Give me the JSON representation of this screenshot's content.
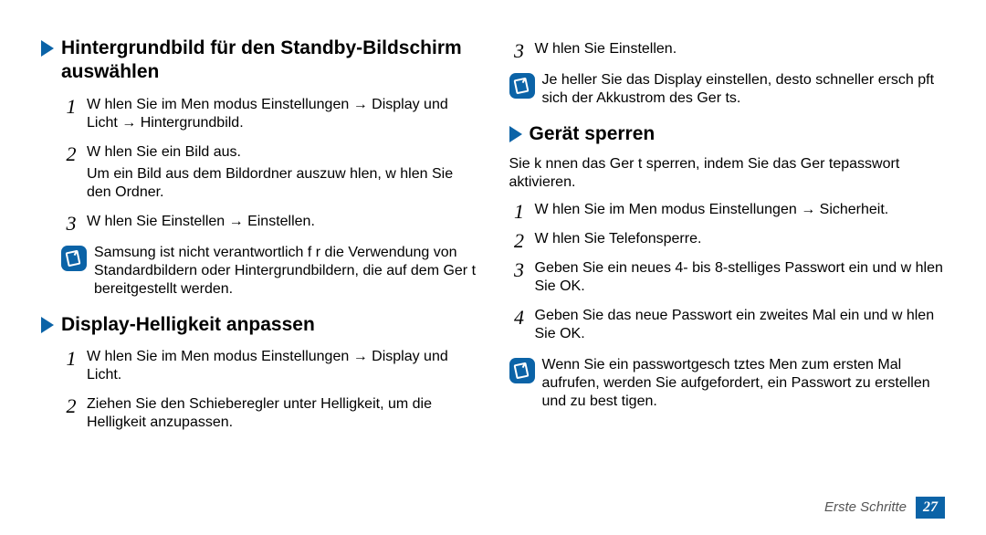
{
  "left": {
    "section1": {
      "title": "Hintergrundbild für den Standby-Bildschirm auswählen",
      "steps": [
        {
          "num": "1",
          "lines": [
            "W hlen Sie im Men modus Einstellungen → Display und Licht → Hintergrundbild."
          ]
        },
        {
          "num": "2",
          "lines": [
            "W hlen Sie ein Bild aus.",
            "Um ein Bild aus dem Bildordner auszuw hlen, w hlen Sie den Ordner."
          ]
        },
        {
          "num": "3",
          "lines": [
            "W hlen Sie Einstellen → Einstellen."
          ]
        }
      ],
      "note": "Samsung ist nicht verantwortlich f r die Verwendung von Standardbildern oder Hintergrundbildern, die auf dem Ger t bereitgestellt werden."
    },
    "section2": {
      "title": "Display-Helligkeit anpassen",
      "steps": [
        {
          "num": "1",
          "lines": [
            "W hlen Sie im Men modus Einstellungen → Display und Licht."
          ]
        },
        {
          "num": "2",
          "lines": [
            "Ziehen Sie den Schieberegler unter Helligkeit, um die Helligkeit anzupassen."
          ]
        }
      ]
    }
  },
  "right": {
    "presteps": [
      {
        "num": "3",
        "lines": [
          "W hlen Sie Einstellen."
        ]
      }
    ],
    "prenote": "Je heller Sie das Display einstellen, desto schneller ersch pft sich der Akkustrom des Ger ts.",
    "section3": {
      "title": "Gerät sperren",
      "intro": "Sie k nnen das Ger t sperren, indem Sie das Ger tepasswort aktivieren.",
      "steps": [
        {
          "num": "1",
          "lines": [
            "W hlen Sie im Men modus Einstellungen → Sicherheit."
          ]
        },
        {
          "num": "2",
          "lines": [
            "W hlen Sie Telefonsperre."
          ]
        },
        {
          "num": "3",
          "lines": [
            "Geben Sie ein neues 4- bis 8-stelliges Passwort ein und w hlen Sie OK."
          ]
        },
        {
          "num": "4",
          "lines": [
            "Geben Sie das neue Passwort ein zweites Mal ein und w hlen Sie OK."
          ]
        }
      ],
      "note": "Wenn Sie ein passwortgesch tztes Men  zum ersten Mal aufrufen, werden Sie aufgefordert, ein Passwort zu erstellen und zu best tigen."
    }
  },
  "footer": {
    "section": "Erste Schritte",
    "page": "27"
  }
}
